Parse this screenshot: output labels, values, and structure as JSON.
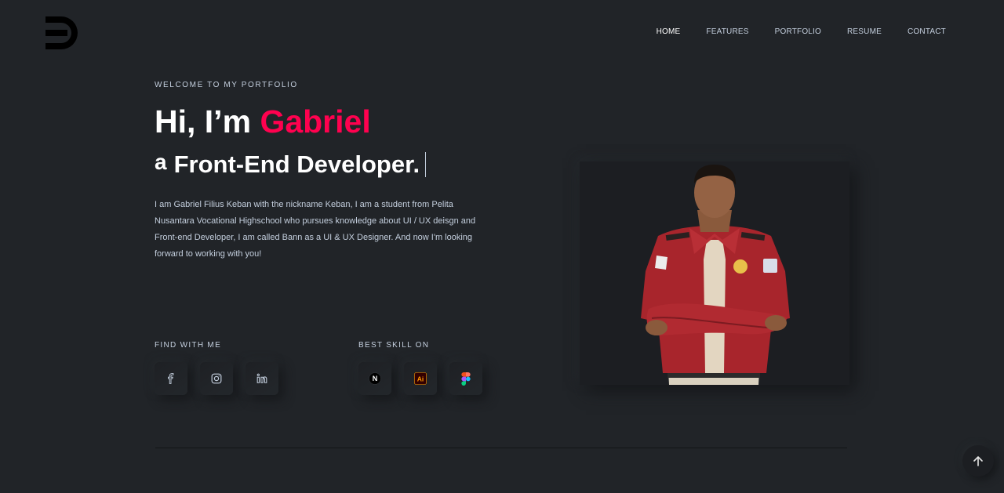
{
  "brand": {
    "logo_icon": "d-logo-icon"
  },
  "nav": {
    "items": [
      {
        "label": "HOME",
        "active": true
      },
      {
        "label": "FEATURES",
        "active": false
      },
      {
        "label": "PORTFOLIO",
        "active": false
      },
      {
        "label": "RESUME",
        "active": false
      },
      {
        "label": "CONTACT",
        "active": false
      }
    ]
  },
  "hero": {
    "welcome": "WELCOME TO MY PORTFOLIO",
    "greeting": "Hi, I’m",
    "name": "Gabriel",
    "role_prefix": "a",
    "role": "Front-End Developer.",
    "description": "I am Gabriel Filius Keban with the nickname Keban, I am a student from Pelita Nusantara Vocational Highschool who pursues knowledge about UI / UX deisgn and Front-end Developer, I am called Bann as a UI & UX Designer. And now I'm looking forward to working with you!"
  },
  "find_with_me": {
    "label": "FIND WITH ME",
    "icons": [
      "facebook-icon",
      "instagram-icon",
      "linkedin-icon"
    ]
  },
  "best_skill": {
    "label": "BEST SKILL ON",
    "icons": [
      "nextjs-icon",
      "illustrator-icon",
      "figma-icon"
    ],
    "illustrator_text": "Ai",
    "nextjs_text": "N"
  },
  "colors": {
    "background": "#212428",
    "accent": "#ff014f",
    "text": "#c4cfde",
    "heading": "#ffffff"
  },
  "scroll_top": {
    "icon": "arrow-up-icon"
  }
}
